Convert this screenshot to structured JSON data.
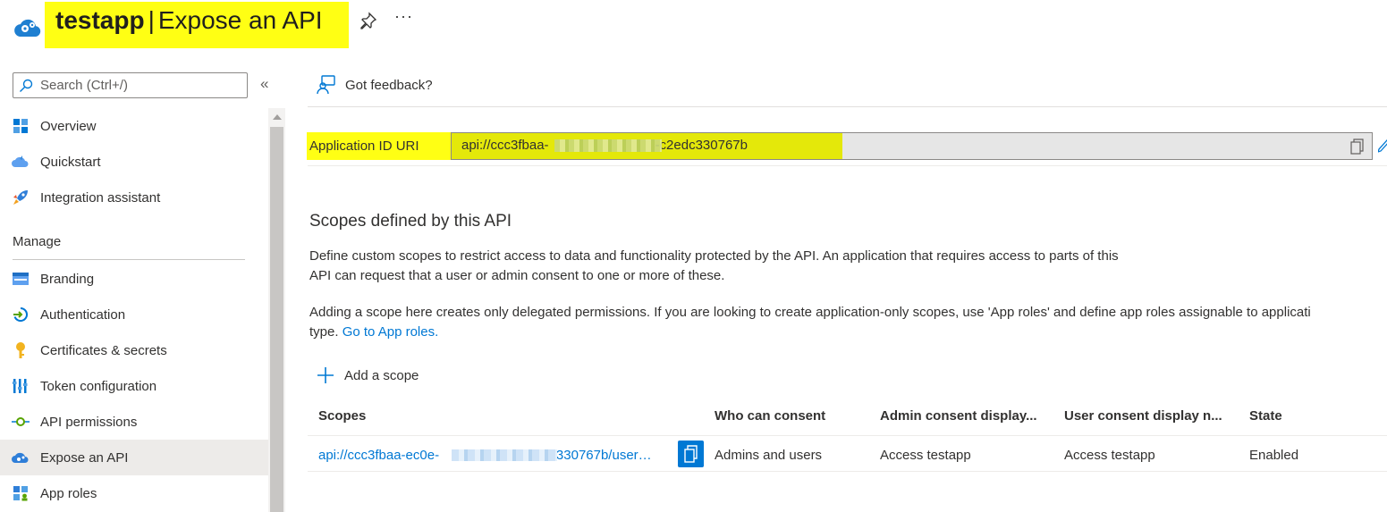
{
  "header": {
    "app_name": "testapp",
    "separator": "|",
    "page_title": "Expose an API",
    "more_label": "···"
  },
  "sidebar": {
    "search_placeholder": "Search (Ctrl+/)",
    "collapse_label": "«",
    "items": [
      {
        "label": "Overview",
        "icon": "overview-icon"
      },
      {
        "label": "Quickstart",
        "icon": "quickstart-icon"
      },
      {
        "label": "Integration assistant",
        "icon": "rocket-icon"
      }
    ],
    "manage_label": "Manage",
    "manage_items": [
      {
        "label": "Branding",
        "icon": "branding-icon"
      },
      {
        "label": "Authentication",
        "icon": "authentication-icon"
      },
      {
        "label": "Certificates & secrets",
        "icon": "key-icon"
      },
      {
        "label": "Token configuration",
        "icon": "token-icon"
      },
      {
        "label": "API permissions",
        "icon": "api-permissions-icon"
      },
      {
        "label": "Expose an API",
        "icon": "expose-api-icon",
        "active": true
      },
      {
        "label": "App roles",
        "icon": "app-roles-icon"
      }
    ]
  },
  "main": {
    "feedback_label": "Got feedback?",
    "app_id_uri_label": "Application ID URI",
    "app_id_uri_prefix": "api://ccc3fbaa-",
    "app_id_uri_suffix": "-c2edc330767b",
    "scopes_heading": "Scopes defined by this API",
    "scopes_desc_line1": "Define custom scopes to restrict access to data and functionality protected by the API. An application that requires access to parts of this",
    "scopes_desc_line2": "API can request that a user or admin consent to one or more of these.",
    "scope_note_line1": "Adding a scope here creates only delegated permissions. If you are looking to create application-only scopes, use 'App roles' and define app roles assignable to applicati",
    "scope_note_line2_prefix": "type.",
    "scope_note_link": "Go to App roles.",
    "add_scope_label": "Add a scope",
    "table": {
      "headers": [
        "Scopes",
        "Who can consent",
        "Admin consent display...",
        "User consent display n...",
        "State"
      ],
      "rows": [
        {
          "scope_prefix": "api://ccc3fbaa-ec0e-",
          "scope_suffix": "lc330767b/user…",
          "who": "Admins and users",
          "admin_display": "Access testapp",
          "user_display": "Access testapp",
          "state": "Enabled"
        }
      ]
    }
  },
  "colors": {
    "highlight": "#ffff14",
    "link": "#0078d4",
    "active_bg": "#edebe9"
  }
}
